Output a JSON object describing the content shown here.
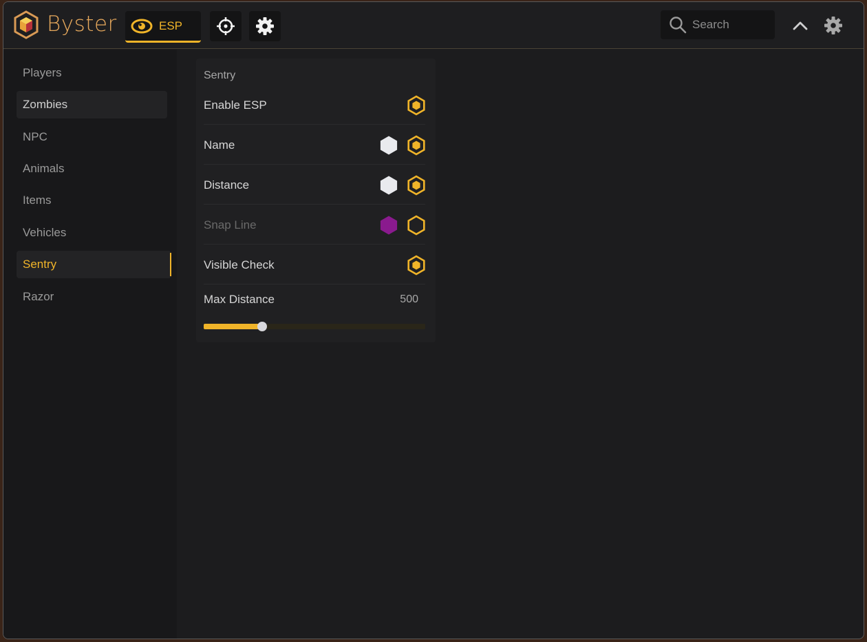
{
  "app": {
    "brand": "Byster",
    "accent": "#f0b429"
  },
  "header": {
    "tabs": [
      {
        "label": "ESP",
        "icon": "eye-icon",
        "active": true
      },
      {
        "label": "",
        "icon": "crosshair-icon",
        "active": false
      },
      {
        "label": "",
        "icon": "gear-icon",
        "active": false
      }
    ],
    "search_placeholder": "Search",
    "collapse_icon": "chevron-up-icon",
    "settings_icon": "gear-icon"
  },
  "sidebar": {
    "items": [
      {
        "label": "Players",
        "state": "normal"
      },
      {
        "label": "Zombies",
        "state": "hover"
      },
      {
        "label": "NPC",
        "state": "normal"
      },
      {
        "label": "Animals",
        "state": "normal"
      },
      {
        "label": "Items",
        "state": "normal"
      },
      {
        "label": "Vehicles",
        "state": "normal"
      },
      {
        "label": "Sentry",
        "state": "active"
      },
      {
        "label": "Razor",
        "state": "normal"
      }
    ]
  },
  "panel": {
    "title": "Sentry",
    "rows": [
      {
        "label": "Enable ESP",
        "color": null,
        "toggle": "on",
        "disabled": false
      },
      {
        "label": "Name",
        "color": "#e9eaee",
        "toggle": "on",
        "disabled": false
      },
      {
        "label": "Distance",
        "color": "#e9eaee",
        "toggle": "on",
        "disabled": false
      },
      {
        "label": "Snap Line",
        "color": "#8a1a8e",
        "toggle": "off",
        "disabled": true
      },
      {
        "label": "Visible Check",
        "color": null,
        "toggle": "on",
        "disabled": false
      }
    ],
    "max_distance": {
      "label": "Max Distance",
      "value": "500",
      "fraction": 0.265
    }
  }
}
